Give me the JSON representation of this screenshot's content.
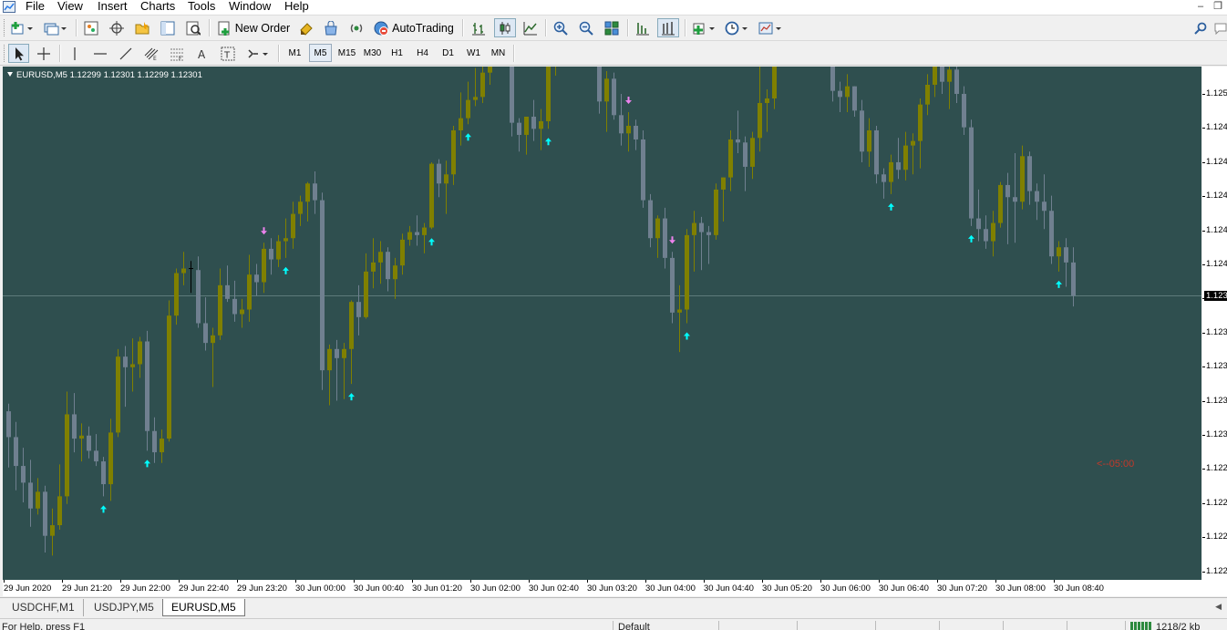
{
  "menubar": {
    "items": [
      "File",
      "View",
      "Insert",
      "Charts",
      "Tools",
      "Window",
      "Help"
    ]
  },
  "toolbar": {
    "new_order": "New Order",
    "auto_trading": "AutoTrading"
  },
  "timeframes": [
    "M1",
    "M5",
    "M15",
    "M30",
    "H1",
    "H4",
    "D1",
    "W1",
    "MN"
  ],
  "active_timeframe": "M5",
  "chart": {
    "title": "EURUSD,M5  1.12299 1.12301 1.12299 1.12301",
    "timer": "<--05:00",
    "background": "#2f4f4f",
    "bull_color": "#808000",
    "bear_color": "#708090",
    "cross_color": "#000000",
    "up_arrow_color": "#00ffff",
    "down_arrow_color": "#ee82ee",
    "timer_color": "#c0392b"
  },
  "price_axis": {
    "labels": [
      "1.125",
      "1.124",
      "1.124",
      "1.124",
      "1.124",
      "1.124",
      "1.123",
      "1.123",
      "1.123",
      "1.123",
      "1.123",
      "1.122",
      "1.122",
      "1.122",
      "1.122"
    ],
    "current": "1.123"
  },
  "time_axis": {
    "labels": [
      "29 Jun 2020",
      "29 Jun 21:20",
      "29 Jun 22:00",
      "29 Jun 22:40",
      "29 Jun 23:20",
      "30 Jun 00:00",
      "30 Jun 00:40",
      "30 Jun 01:20",
      "30 Jun 02:00",
      "30 Jun 02:40",
      "30 Jun 03:20",
      "30 Jun 04:00",
      "30 Jun 04:40",
      "30 Jun 05:20",
      "30 Jun 06:00",
      "30 Jun 06:40",
      "30 Jun 07:20",
      "30 Jun 08:00",
      "30 Jun 08:40"
    ]
  },
  "tabs": [
    "USDCHF,M1",
    "USDJPY,M5",
    "EURUSD,M5"
  ],
  "active_tab": "EURUSD,M5",
  "statusbar": {
    "help": "For Help, press F1",
    "profile": "Default",
    "traffic": "1218/2 kb"
  },
  "chart_data": {
    "type": "candlestick",
    "symbol": "EURUSD",
    "timeframe": "M5",
    "x_first": "29 Jun 2020",
    "x_last": "30 Jun 08:40",
    "y_range": [
      1.1219,
      1.1251
    ],
    "candle_count": 148,
    "series": [
      {
        "name": "candles",
        "values": [
          [
            1.12292,
            1.12297,
            1.12255,
            1.12275
          ],
          [
            1.12275,
            1.12285,
            1.1224,
            1.12256
          ],
          [
            1.12256,
            1.12268,
            1.12232,
            1.12245
          ],
          [
            1.12245,
            1.1226,
            1.12216,
            1.12228
          ],
          [
            1.12228,
            1.12248,
            1.12224,
            1.12239
          ],
          [
            1.12239,
            1.12243,
            1.12199,
            1.1221
          ],
          [
            1.1221,
            1.12228,
            1.12197,
            1.12217
          ],
          [
            1.12217,
            1.12257,
            1.12214,
            1.12236
          ],
          [
            1.12236,
            1.12305,
            1.12231,
            1.1229
          ],
          [
            1.1229,
            1.12304,
            1.12265,
            1.12274
          ],
          [
            1.12274,
            1.12284,
            1.12259,
            1.12276
          ],
          [
            1.12276,
            1.12282,
            1.12261,
            1.12266
          ],
          [
            1.12266,
            1.12277,
            1.12256,
            1.12259
          ],
          [
            1.12259,
            1.12262,
            1.12236,
            1.12244
          ],
          [
            1.12244,
            1.12287,
            1.12233,
            1.12278
          ],
          [
            1.12278,
            1.12333,
            1.12275,
            1.12328
          ],
          [
            1.12328,
            1.12335,
            1.12295,
            1.12321
          ],
          [
            1.12321,
            1.1234,
            1.12305,
            1.12323
          ],
          [
            1.12323,
            1.12341,
            1.12314,
            1.12338
          ],
          [
            1.12338,
            1.12345,
            1.12266,
            1.12279
          ],
          [
            1.12279,
            1.12288,
            1.12258,
            1.12265
          ],
          [
            1.12265,
            1.1228,
            1.12258,
            1.12274
          ],
          [
            1.12274,
            1.12365,
            1.12272,
            1.12355
          ],
          [
            1.12355,
            1.12386,
            1.12349,
            1.12383
          ],
          [
            1.12383,
            1.12397,
            1.12375,
            1.12386
          ],
          [
            1.12386,
            1.12391,
            1.1237,
            1.12385
          ],
          [
            1.12385,
            1.12394,
            1.12347,
            1.1235
          ],
          [
            1.1235,
            1.12367,
            1.12332,
            1.12337
          ],
          [
            1.12337,
            1.12347,
            1.12308,
            1.12342
          ],
          [
            1.12342,
            1.12386,
            1.12339,
            1.12375
          ],
          [
            1.12375,
            1.12388,
            1.12364,
            1.12366
          ],
          [
            1.12366,
            1.12378,
            1.12351,
            1.12356
          ],
          [
            1.12356,
            1.12366,
            1.12347,
            1.12359
          ],
          [
            1.12359,
            1.12395,
            1.12351,
            1.12382
          ],
          [
            1.12382,
            1.12389,
            1.12368,
            1.12377
          ],
          [
            1.12377,
            1.12403,
            1.1237,
            1.12399
          ],
          [
            1.12399,
            1.12406,
            1.12382,
            1.12392
          ],
          [
            1.12392,
            1.12408,
            1.12387,
            1.12404
          ],
          [
            1.12404,
            1.12419,
            1.12393,
            1.12406
          ],
          [
            1.12406,
            1.1243,
            1.12399,
            1.12422
          ],
          [
            1.12422,
            1.12434,
            1.12414,
            1.1243
          ],
          [
            1.1243,
            1.12443,
            1.12417,
            1.12442
          ],
          [
            1.12442,
            1.1245,
            1.12422,
            1.12431
          ],
          [
            1.12431,
            1.12436,
            1.12306,
            1.12319
          ],
          [
            1.12319,
            1.12336,
            1.12296,
            1.12333
          ],
          [
            1.12333,
            1.12339,
            1.12299,
            1.12327
          ],
          [
            1.12327,
            1.12337,
            1.123,
            1.12333
          ],
          [
            1.12333,
            1.12365,
            1.1231,
            1.12364
          ],
          [
            1.12364,
            1.12375,
            1.12342,
            1.12354
          ],
          [
            1.12354,
            1.12396,
            1.12353,
            1.12384
          ],
          [
            1.12384,
            1.12406,
            1.12373,
            1.1239
          ],
          [
            1.1239,
            1.12404,
            1.12376,
            1.12397
          ],
          [
            1.12397,
            1.124,
            1.12371,
            1.12379
          ],
          [
            1.12379,
            1.12393,
            1.12366,
            1.12388
          ],
          [
            1.12388,
            1.12409,
            1.12382,
            1.12405
          ],
          [
            1.12405,
            1.12414,
            1.12401,
            1.1241
          ],
          [
            1.1241,
            1.12421,
            1.12401,
            1.12408
          ],
          [
            1.12408,
            1.12416,
            1.12396,
            1.12413
          ],
          [
            1.12413,
            1.12456,
            1.12412,
            1.12455
          ],
          [
            1.12455,
            1.12458,
            1.12433,
            1.12442
          ],
          [
            1.12442,
            1.12457,
            1.12422,
            1.12448
          ],
          [
            1.12448,
            1.1248,
            1.12441,
            1.12477
          ],
          [
            1.12477,
            1.12502,
            1.12467,
            1.12485
          ],
          [
            1.12485,
            1.12509,
            1.12481,
            1.12497
          ],
          [
            1.12497,
            1.12518,
            1.12493,
            1.12499
          ],
          [
            1.12499,
            1.12526,
            1.12495,
            1.12515
          ],
          [
            1.12515,
            1.12549,
            1.12507,
            1.12541
          ],
          [
            1.12541,
            1.12552,
            1.1252,
            1.12536
          ],
          [
            1.12536,
            1.12562,
            1.12533,
            1.12552
          ],
          [
            1.12552,
            1.12557,
            1.12473,
            1.12482
          ],
          [
            1.12482,
            1.12485,
            1.12463,
            1.12474
          ],
          [
            1.12474,
            1.12486,
            1.12461,
            1.12486
          ],
          [
            1.12486,
            1.12497,
            1.1247,
            1.12478
          ],
          [
            1.12478,
            1.12491,
            1.12464,
            1.12483
          ],
          [
            1.12483,
            1.12525,
            1.12478,
            1.12522
          ],
          [
            1.12522,
            1.12607,
            1.12513,
            1.12602
          ],
          [
            1.12602,
            1.12614,
            1.12585,
            1.12597
          ],
          [
            1.12597,
            1.12625,
            1.12589,
            1.12615
          ],
          [
            1.12615,
            1.12629,
            1.12592,
            1.12597
          ],
          [
            1.12597,
            1.12605,
            1.12576,
            1.12592
          ],
          [
            1.12592,
            1.12595,
            1.12544,
            1.12551
          ],
          [
            1.12551,
            1.12554,
            1.12488,
            1.12496
          ],
          [
            1.12496,
            1.12516,
            1.12476,
            1.12511
          ],
          [
            1.12511,
            1.12515,
            1.12484,
            1.12487
          ],
          [
            1.12487,
            1.12501,
            1.12467,
            1.12475
          ],
          [
            1.12475,
            1.12489,
            1.12463,
            1.1248
          ],
          [
            1.1248,
            1.12484,
            1.12464,
            1.12471
          ],
          [
            1.12471,
            1.12477,
            1.12426,
            1.12431
          ],
          [
            1.12431,
            1.12435,
            1.124,
            1.12406
          ],
          [
            1.12406,
            1.12421,
            1.12393,
            1.12419
          ],
          [
            1.12419,
            1.12426,
            1.12386,
            1.12393
          ],
          [
            1.12393,
            1.12397,
            1.1235,
            1.12357
          ],
          [
            1.12357,
            1.12375,
            1.12331,
            1.12359
          ],
          [
            1.12359,
            1.12412,
            1.1235,
            1.12408
          ],
          [
            1.12408,
            1.12424,
            1.12384,
            1.12416
          ],
          [
            1.12416,
            1.1242,
            1.12385,
            1.1241
          ],
          [
            1.1241,
            1.12414,
            1.12389,
            1.12408
          ],
          [
            1.12408,
            1.12442,
            1.12405,
            1.12438
          ],
          [
            1.12438,
            1.12446,
            1.12417,
            1.12446
          ],
          [
            1.12446,
            1.12477,
            1.12437,
            1.12471
          ],
          [
            1.12471,
            1.1249,
            1.12462,
            1.12469
          ],
          [
            1.12469,
            1.12473,
            1.12437,
            1.12453
          ],
          [
            1.12453,
            1.12476,
            1.12445,
            1.12472
          ],
          [
            1.12472,
            1.12526,
            1.12463,
            1.12495
          ],
          [
            1.12495,
            1.12504,
            1.12476,
            1.12498
          ],
          [
            1.12498,
            1.12544,
            1.12491,
            1.12537
          ],
          [
            1.12537,
            1.12561,
            1.1253,
            1.12556
          ],
          [
            1.12556,
            1.12569,
            1.1255,
            1.12566
          ],
          [
            1.12566,
            1.12593,
            1.12548,
            1.12582
          ],
          [
            1.12582,
            1.12599,
            1.1256,
            1.12591
          ],
          [
            1.12591,
            1.12596,
            1.12552,
            1.1256
          ],
          [
            1.1256,
            1.12587,
            1.12534,
            1.12574
          ],
          [
            1.12574,
            1.12582,
            1.12524,
            1.1253
          ],
          [
            1.1253,
            1.12534,
            1.12496,
            1.12503
          ],
          [
            1.12503,
            1.12509,
            1.12489,
            1.12499
          ],
          [
            1.12499,
            1.12514,
            1.12489,
            1.12506
          ],
          [
            1.12506,
            1.12506,
            1.12486,
            1.1249
          ],
          [
            1.1249,
            1.12497,
            1.12456,
            1.12463
          ],
          [
            1.12463,
            1.12485,
            1.12453,
            1.12477
          ],
          [
            1.12477,
            1.1248,
            1.12442,
            1.12448
          ],
          [
            1.12448,
            1.12452,
            1.12432,
            1.12443
          ],
          [
            1.12443,
            1.12461,
            1.12435,
            1.12456
          ],
          [
            1.12456,
            1.12472,
            1.12445,
            1.12451
          ],
          [
            1.12451,
            1.12476,
            1.12444,
            1.12467
          ],
          [
            1.12467,
            1.12475,
            1.12448,
            1.1247
          ],
          [
            1.1247,
            1.12498,
            1.12452,
            1.12494
          ],
          [
            1.12494,
            1.12514,
            1.12487,
            1.12507
          ],
          [
            1.12507,
            1.12524,
            1.12499,
            1.12521
          ],
          [
            1.12521,
            1.12527,
            1.12501,
            1.12509
          ],
          [
            1.12509,
            1.12527,
            1.12491,
            1.12517
          ],
          [
            1.12517,
            1.12521,
            1.12495,
            1.12501
          ],
          [
            1.12501,
            1.12506,
            1.12474,
            1.12479
          ],
          [
            1.12479,
            1.12484,
            1.12414,
            1.12419
          ],
          [
            1.12419,
            1.12438,
            1.12404,
            1.12412
          ],
          [
            1.12412,
            1.12421,
            1.12399,
            1.12404
          ],
          [
            1.12404,
            1.12424,
            1.12394,
            1.12416
          ],
          [
            1.12416,
            1.12443,
            1.12413,
            1.12441
          ],
          [
            1.12441,
            1.12449,
            1.12402,
            1.12433
          ],
          [
            1.12433,
            1.12462,
            1.12403,
            1.1243
          ],
          [
            1.1243,
            1.12467,
            1.12425,
            1.1246
          ],
          [
            1.1246,
            1.12463,
            1.12428,
            1.12437
          ],
          [
            1.12437,
            1.12442,
            1.12418,
            1.1243
          ],
          [
            1.1243,
            1.12448,
            1.12412,
            1.12424
          ],
          [
            1.12424,
            1.12434,
            1.12389,
            1.12394
          ],
          [
            1.12394,
            1.12404,
            1.12384,
            1.124
          ],
          [
            1.124,
            1.12406,
            1.12374,
            1.1239
          ],
          [
            1.1239,
            1.124,
            1.12361,
            1.12368
          ]
        ]
      },
      {
        "name": "up_arrows",
        "candle_index": [
          13,
          19,
          38,
          47,
          58,
          63,
          74,
          93,
          109,
          121,
          132,
          144
        ]
      },
      {
        "name": "down_arrows",
        "candle_index": [
          35,
          66,
          76,
          85,
          91,
          103
        ]
      }
    ]
  }
}
